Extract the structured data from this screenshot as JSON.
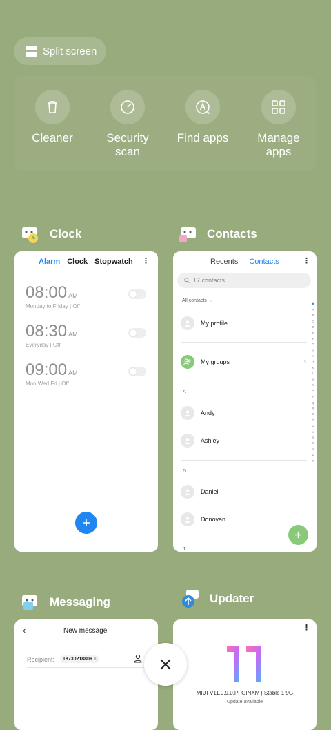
{
  "split_screen": {
    "label": "Split screen"
  },
  "tools": [
    {
      "label": "Cleaner",
      "icon": "trash-icon"
    },
    {
      "label": "Security\nscan",
      "icon": "speedometer-icon"
    },
    {
      "label": "Find apps",
      "icon": "find-apps-icon"
    },
    {
      "label": "Manage\napps",
      "icon": "grid-icon"
    }
  ],
  "apps": {
    "clock": {
      "name": "Clock",
      "tabs": [
        "Alarm",
        "Clock",
        "Stopwatch"
      ],
      "alarms": [
        {
          "time": "08:00",
          "ampm": "AM",
          "repeat": "Monday to Friday",
          "status": "Off"
        },
        {
          "time": "08:30",
          "ampm": "AM",
          "repeat": "Everyday",
          "status": "Off"
        },
        {
          "time": "09:00",
          "ampm": "AM",
          "repeat": "Mon Wed Fri",
          "status": "Off"
        }
      ]
    },
    "contacts": {
      "name": "Contacts",
      "tabs": [
        "Recents",
        "Contacts"
      ],
      "search_placeholder": "17 contacts",
      "filter": "All contacts",
      "my_profile": "My profile",
      "my_groups": "My groups",
      "section_a": "A",
      "section_d": "D",
      "section_j": "J",
      "contacts_a": [
        "Andy",
        "Ashley"
      ],
      "contacts_d": [
        "Daniel",
        "Donovan"
      ],
      "alphabet": [
        "A",
        "B",
        "C",
        "D",
        "E",
        "F",
        "G",
        "H",
        "I",
        "J",
        "K",
        "L",
        "M",
        "N",
        "O",
        "P",
        "Q",
        "R",
        "S",
        "T",
        "U",
        "V",
        "W",
        "X",
        "Y",
        "Z",
        "#"
      ]
    },
    "messaging": {
      "name": "Messaging",
      "title": "New message",
      "recipient_label": "Recipient:",
      "recipient_number": "18730218809",
      "chip_close": "×"
    },
    "updater": {
      "name": "Updater",
      "version": "MIUI V11.0.9.0.PFGINXM | Stable 1.9G",
      "status": "Update available"
    }
  },
  "colors": {
    "background": "#98ab7c",
    "accent_blue": "#1f86f2",
    "contacts_green": "#8bc97a"
  }
}
